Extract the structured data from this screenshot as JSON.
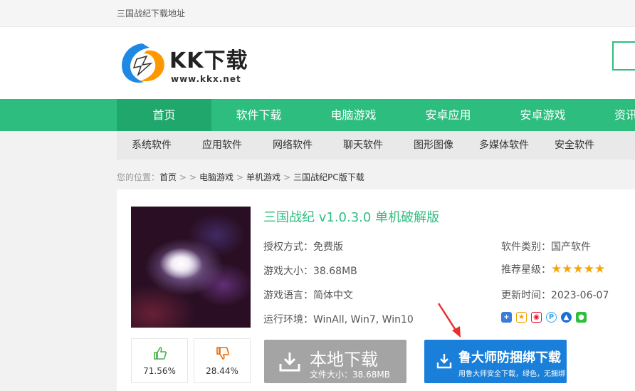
{
  "topbar": {
    "crumb": "三国战纪下载地址"
  },
  "logo": {
    "text": "KK下载",
    "url": "www.kkx.net"
  },
  "nav": [
    "首页",
    "软件下载",
    "电脑游戏",
    "安卓应用",
    "安卓游戏",
    "资讯"
  ],
  "subnav": [
    "系统软件",
    "应用软件",
    "网络软件",
    "聊天软件",
    "图形图像",
    "多媒体软件",
    "安全软件"
  ],
  "breadcrumb": {
    "prefix": "您的位置：",
    "home": "首页",
    "sep1": "> >",
    "cat": "电脑游戏",
    "sep2": ">",
    "sub": "单机游戏",
    "sep3": ">",
    "current": "三国战纪PC版下载"
  },
  "game": {
    "title": "三国战纪 v1.0.3.0 单机破解版",
    "license_label": "授权方式：",
    "license": "免费版",
    "size_label": "游戏大小：",
    "size": "38.68MB",
    "lang_label": "游戏语言：",
    "lang": "简体中文",
    "env_label": "运行环境：",
    "env": "WinAll, Win7, Win10",
    "category_label": "软件类别：",
    "category": "国产软件",
    "rating_label": "推荐星级：",
    "rating_stars": "★★★★★",
    "rating": 5,
    "updated_label": "更新时间：",
    "updated": "2023-06-07"
  },
  "votes": {
    "up": "71.56%",
    "down": "28.44%"
  },
  "buttons": {
    "local_main": "本地下载",
    "local_sub": "文件大小：38.68MB",
    "ld_main": "鲁大师防捆绑下载",
    "ld_sub": "用鲁大师安全下载，绿色，无捆绑"
  },
  "colors": {
    "brand": "#2dbe7f",
    "nav_active": "#20a86c",
    "download_blue": "#1a7fd8",
    "download_gray": "#a4a4a4",
    "star": "#f5a50b",
    "annotation_arrow": "#e8312f"
  }
}
